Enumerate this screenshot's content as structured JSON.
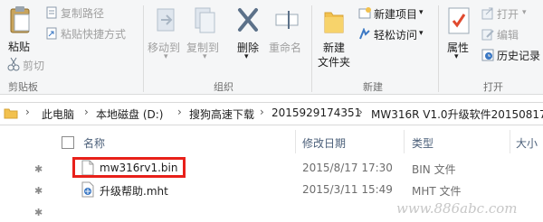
{
  "ribbon": {
    "clipboard": {
      "label": "剪贴板",
      "paste": "粘贴",
      "copy_path": "复制路径",
      "paste_shortcut": "粘贴快捷方式",
      "cut": "剪切"
    },
    "organize": {
      "label": "组织",
      "move_to": "移动到",
      "copy_to": "复制到",
      "delete": "删除",
      "rename": "重命名"
    },
    "new": {
      "label": "新建",
      "new_folder_line1": "新建",
      "new_folder_line2": "文件夹",
      "new_item": "新建项目",
      "easy_access": "轻松访问"
    },
    "open": {
      "label": "打开",
      "properties": "属性",
      "open": "打开",
      "edit": "编辑",
      "history": "历史记录"
    }
  },
  "address": {
    "crumbs": [
      "此电脑",
      "本地磁盘 (D:)",
      "搜狗高速下载",
      "2015929174351",
      "MW316R V1.0升级软件20150817"
    ]
  },
  "columns": {
    "name": "名称",
    "date": "修改日期",
    "type": "类型",
    "size": "大小"
  },
  "files": [
    {
      "name": "mw316rv1.bin",
      "date": "2015/8/17 17:30",
      "type": "BIN 文件",
      "icon": "bin-file-icon"
    },
    {
      "name": "升级帮助.mht",
      "date": "2015/3/11 15:49",
      "type": "MHT 文件",
      "icon": "mht-file-icon"
    }
  ],
  "watermark": "www.886abc.com",
  "colors": {
    "highlight_box": "#e8201a",
    "folder": "#f2c14e",
    "delete_red": "#2b5797"
  }
}
